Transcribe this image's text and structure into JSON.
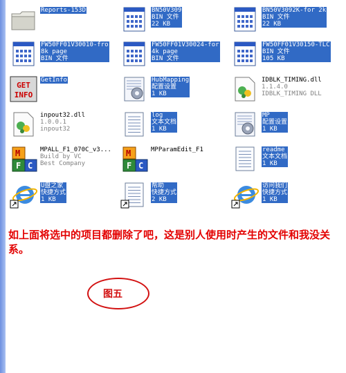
{
  "files": [
    {
      "id": "reports",
      "icon": "folder-icon",
      "selected": true,
      "lines": [
        "Reports-153D"
      ]
    },
    {
      "id": "bn50v309",
      "icon": "bin-file-icon",
      "selected": true,
      "lines": [
        "BN50V309",
        "BIN 文件",
        "22 KB"
      ]
    },
    {
      "id": "bn50v3092k",
      "icon": "bin-file-icon",
      "selected": true,
      "lines": [
        "BN50V3092K-for 2k",
        "BIN 文件",
        "22 KB"
      ]
    },
    {
      "id": "fw30010",
      "icon": "bin-file-icon",
      "selected": true,
      "lines": [
        "FW50FF01V30010-fro",
        "8k page",
        "BIN 文件"
      ]
    },
    {
      "id": "fw30024",
      "icon": "bin-file-icon",
      "selected": true,
      "lines": [
        "FW50FF01V30024-for",
        "4k page",
        "BIN 文件"
      ]
    },
    {
      "id": "fw30150",
      "icon": "bin-file-icon",
      "selected": true,
      "lines": [
        "FW50FF01V30150-TLC",
        "BIN 文件",
        "105 KB"
      ]
    },
    {
      "id": "getinfo",
      "icon": "getinfo-app-icon",
      "selected": true,
      "lines": [
        "GetInfo"
      ],
      "badge": [
        "GET",
        "INFO"
      ]
    },
    {
      "id": "hubmapping",
      "icon": "config-file-icon",
      "selected": true,
      "lines": [
        "HubMapping",
        "配置设置",
        "1 KB"
      ]
    },
    {
      "id": "idblk",
      "icon": "dll-file-icon",
      "selected": false,
      "lines": [
        "IDBLK_TIMING.dll",
        "1.1.4.0",
        "IDBLK_TIMING DLL"
      ]
    },
    {
      "id": "inpout32",
      "icon": "dll-file-icon",
      "selected": false,
      "lines": [
        "inpout32.dll",
        "1.0.0.1",
        "inpout32"
      ]
    },
    {
      "id": "log",
      "icon": "text-file-icon",
      "selected": true,
      "lines": [
        "log",
        "文本文档",
        "1 KB"
      ]
    },
    {
      "id": "mp",
      "icon": "config-file-icon",
      "selected": true,
      "lines": [
        "MP",
        "配置设置",
        "1 KB"
      ]
    },
    {
      "id": "mpall",
      "icon": "mfc-app-icon",
      "selected": false,
      "lines": [
        "MPALL_F1_070C_v3...",
        "Build by VC",
        "Best Company"
      ]
    },
    {
      "id": "mpparamedit",
      "icon": "mfc-app-icon",
      "selected": false,
      "lines": [
        "MPParamEdit_F1"
      ]
    },
    {
      "id": "readme",
      "icon": "text-file-icon",
      "selected": true,
      "lines": [
        "readme",
        "文本文档",
        "1 KB"
      ]
    },
    {
      "id": "upan",
      "icon": "ie-shortcut-icon",
      "selected": true,
      "lines": [
        "U盘之家",
        "快捷方式",
        "1 KB"
      ]
    },
    {
      "id": "help",
      "icon": "text-shortcut-icon",
      "selected": true,
      "lines": [
        "帮助",
        "快捷方式",
        "2 KB"
      ]
    },
    {
      "id": "visit",
      "icon": "ie-shortcut-icon",
      "selected": true,
      "lines": [
        "访问我们",
        "快捷方式",
        "1 KB"
      ]
    }
  ],
  "caption": "如上面将选中的项目都删除了吧，这是别人使用时产生的文件和我没关系。",
  "figure_label": "图五",
  "colors": {
    "selection": "#316ac5",
    "caption": "#e30000"
  }
}
